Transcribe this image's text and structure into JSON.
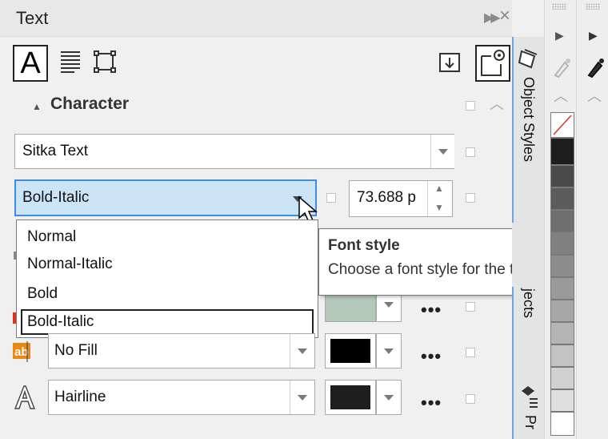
{
  "panel": {
    "title": "Text",
    "section_label": "Character",
    "char_icon_glyph": "A",
    "font_family": "Sitka Text",
    "font_style": "Bold-Italic",
    "font_size": "73.688 p",
    "font_style_options": [
      "Normal",
      "Normal-Italic",
      "Bold",
      "Bold-Italic"
    ],
    "fill_type": "No Fill",
    "outline_width": "Hairline",
    "more_label": "•••"
  },
  "tooltip": {
    "title": "Font style",
    "body": "Choose a font style for the text."
  },
  "dockers": {
    "object_styles": "Object Styles",
    "objects": "jects",
    "properties": "Pr"
  },
  "colors": {
    "accent": "#3d8ee0",
    "selected_bg": "#cce4f7",
    "fill_swatch": "#b4c9bb",
    "bg_swatch": "#000000",
    "outline_swatch": "#1e1e1e"
  },
  "palette": [
    "none",
    "#1e1e1e",
    "#4a4a4a",
    "#5c5c5c",
    "#6e6e6e",
    "#808080",
    "#8c8c8c",
    "#9a9a9a",
    "#a7a7a7",
    "#b4b4b4",
    "#c2c2c2",
    "#d0d0d0",
    "#dedede",
    "#ffffff"
  ],
  "icons": [
    "character-icon",
    "paragraph-icon",
    "frame-icon",
    "import-icon",
    "options-icon",
    "eyedropper-icon",
    "object-styles-icon",
    "properties-icon",
    "background-fill-icon",
    "outline-icon"
  ]
}
